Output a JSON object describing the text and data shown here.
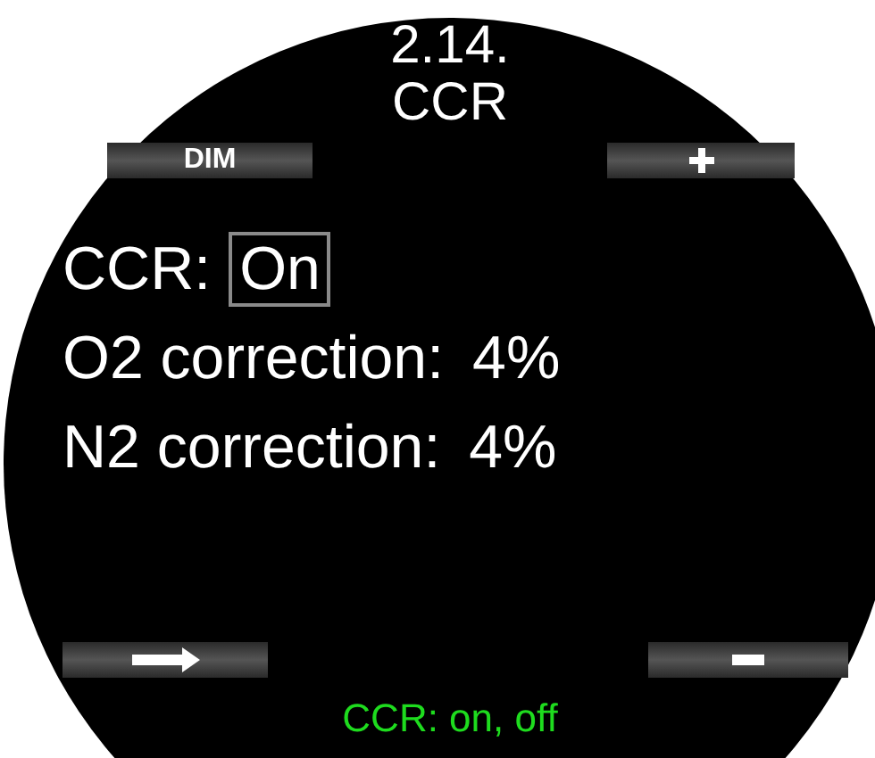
{
  "header": {
    "number": "2.14.",
    "title": "CCR"
  },
  "top_keys": [
    {
      "kind": "text",
      "label": "DIM"
    },
    {
      "kind": "plus"
    }
  ],
  "settings": [
    {
      "label": "CCR:",
      "value": "On",
      "selected": true
    },
    {
      "label": "O2 correction:",
      "value": "4%",
      "selected": false
    },
    {
      "label": "N2 correction:",
      "value": "4%",
      "selected": false
    }
  ],
  "bottom_keys": [
    {
      "kind": "arrow"
    },
    {
      "kind": "minus"
    }
  ],
  "hint": "CCR: on, off"
}
